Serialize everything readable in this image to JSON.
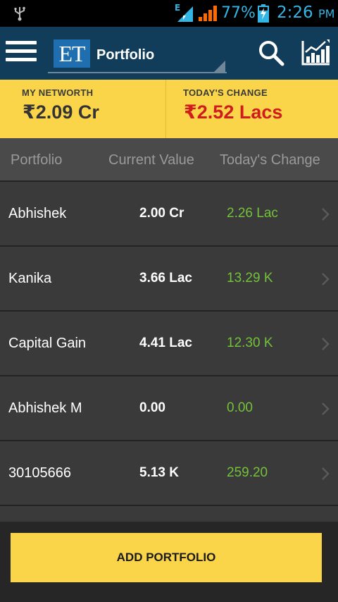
{
  "status_bar": {
    "usb_icon": "usb-icon",
    "network_icon": "network-e-icon",
    "network_label": "E",
    "signal_icon": "signal-icon",
    "battery_percent": "77%",
    "battery_icon": "battery-charging-icon",
    "time": "2:26",
    "ampm": "PM",
    "accent_color": "#33b5e5"
  },
  "app_bar": {
    "menu_icon": "hamburger-menu-icon",
    "logo_text": "ET",
    "title": "Portfolio",
    "search_icon": "search-icon",
    "chart_icon": "chart-icon",
    "background_color": "#113d5a"
  },
  "summary": {
    "networth_label": "MY NETWORTH",
    "networth_value": "₹2.09 Cr",
    "change_label": "TODAY'S CHANGE",
    "change_value": "₹2.52 Lacs",
    "background_color": "#fad54a",
    "change_color": "#d01c1c"
  },
  "table": {
    "headers": [
      "Portfolio",
      "Current Value",
      "Today's Change"
    ],
    "rows": [
      {
        "name": "Abhishek",
        "value": "2.00 Cr",
        "change": "2.26 Lac"
      },
      {
        "name": "Kanika",
        "value": "3.66 Lac",
        "change": "13.29 K"
      },
      {
        "name": "Capital Gain",
        "value": "4.41 Lac",
        "change": "12.30 K"
      },
      {
        "name": "Abhishek M",
        "value": "0.00",
        "change": "0.00"
      },
      {
        "name": "30105666",
        "value": "5.13 K",
        "change": "259.20"
      }
    ],
    "change_color": "#73c23a",
    "row_icon": "chevron-right-icon"
  },
  "footer": {
    "add_button_label": "ADD PORTFOLIO"
  }
}
